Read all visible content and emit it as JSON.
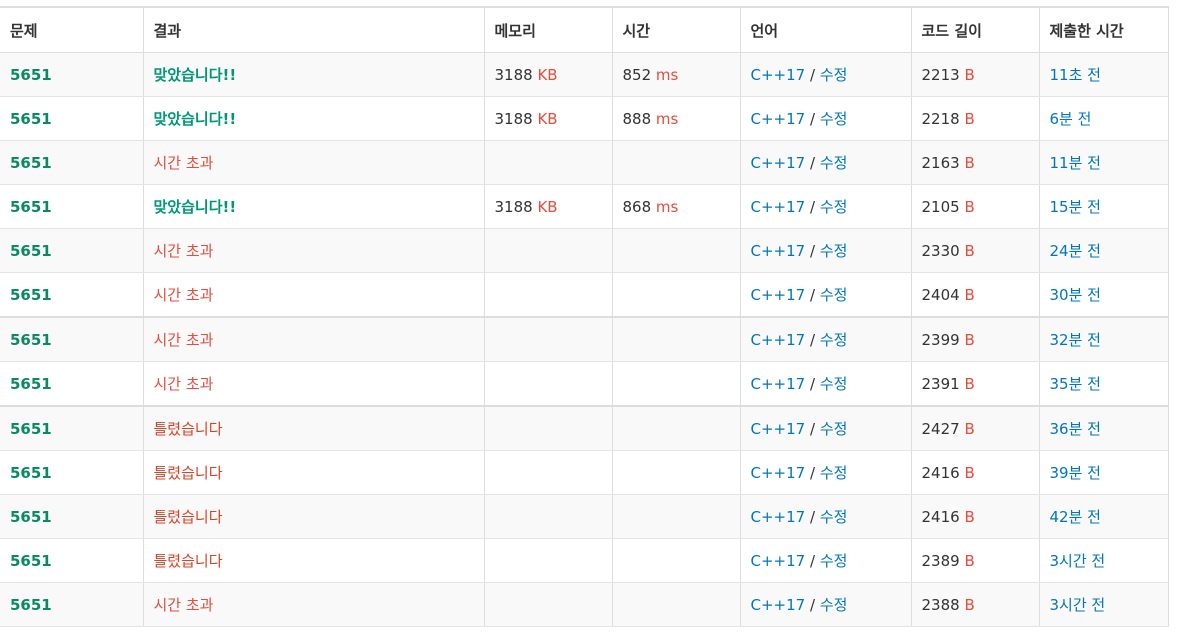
{
  "columns": [
    "문제",
    "결과",
    "메모리",
    "시간",
    "언어",
    "코드 길이",
    "제출한 시간"
  ],
  "rows": [
    {
      "problem": "5651",
      "result": "맞았습니다!!",
      "result_type": "ac",
      "memory": "3188",
      "memory_unit": "KB",
      "time": "852",
      "time_unit": "ms",
      "language": "C++17",
      "slash": "/",
      "edit": "수정",
      "code_length": "2213",
      "code_unit": "B",
      "submitted": "11초 전"
    },
    {
      "problem": "5651",
      "result": "맞았습니다!!",
      "result_type": "ac",
      "memory": "3188",
      "memory_unit": "KB",
      "time": "888",
      "time_unit": "ms",
      "language": "C++17",
      "slash": "/",
      "edit": "수정",
      "code_length": "2218",
      "code_unit": "B",
      "submitted": "6분 전"
    },
    {
      "problem": "5651",
      "result": "시간 초과",
      "result_type": "tle",
      "memory": "",
      "memory_unit": "",
      "time": "",
      "time_unit": "",
      "language": "C++17",
      "slash": "/",
      "edit": "수정",
      "code_length": "2163",
      "code_unit": "B",
      "submitted": "11분 전"
    },
    {
      "problem": "5651",
      "result": "맞았습니다!!",
      "result_type": "ac",
      "memory": "3188",
      "memory_unit": "KB",
      "time": "868",
      "time_unit": "ms",
      "language": "C++17",
      "slash": "/",
      "edit": "수정",
      "code_length": "2105",
      "code_unit": "B",
      "submitted": "15분 전"
    },
    {
      "problem": "5651",
      "result": "시간 초과",
      "result_type": "tle",
      "memory": "",
      "memory_unit": "",
      "time": "",
      "time_unit": "",
      "language": "C++17",
      "slash": "/",
      "edit": "수정",
      "code_length": "2330",
      "code_unit": "B",
      "submitted": "24분 전"
    },
    {
      "problem": "5651",
      "result": "시간 초과",
      "result_type": "tle",
      "memory": "",
      "memory_unit": "",
      "time": "",
      "time_unit": "",
      "language": "C++17",
      "slash": "/",
      "edit": "수정",
      "code_length": "2404",
      "code_unit": "B",
      "submitted": "30분 전"
    },
    {
      "problem": "5651",
      "result": "시간 초과",
      "result_type": "tle",
      "memory": "",
      "memory_unit": "",
      "time": "",
      "time_unit": "",
      "language": "C++17",
      "slash": "/",
      "edit": "수정",
      "code_length": "2399",
      "code_unit": "B",
      "submitted": "32분 전"
    },
    {
      "problem": "5651",
      "result": "시간 초과",
      "result_type": "tle",
      "memory": "",
      "memory_unit": "",
      "time": "",
      "time_unit": "",
      "language": "C++17",
      "slash": "/",
      "edit": "수정",
      "code_length": "2391",
      "code_unit": "B",
      "submitted": "35분 전"
    },
    {
      "problem": "5651",
      "result": "틀렸습니다",
      "result_type": "wa",
      "memory": "",
      "memory_unit": "",
      "time": "",
      "time_unit": "",
      "language": "C++17",
      "slash": "/",
      "edit": "수정",
      "code_length": "2427",
      "code_unit": "B",
      "submitted": "36분 전"
    },
    {
      "problem": "5651",
      "result": "틀렸습니다",
      "result_type": "wa",
      "memory": "",
      "memory_unit": "",
      "time": "",
      "time_unit": "",
      "language": "C++17",
      "slash": "/",
      "edit": "수정",
      "code_length": "2416",
      "code_unit": "B",
      "submitted": "39분 전"
    },
    {
      "problem": "5651",
      "result": "틀렸습니다",
      "result_type": "wa",
      "memory": "",
      "memory_unit": "",
      "time": "",
      "time_unit": "",
      "language": "C++17",
      "slash": "/",
      "edit": "수정",
      "code_length": "2416",
      "code_unit": "B",
      "submitted": "42분 전"
    },
    {
      "problem": "5651",
      "result": "틀렸습니다",
      "result_type": "wa",
      "memory": "",
      "memory_unit": "",
      "time": "",
      "time_unit": "",
      "language": "C++17",
      "slash": "/",
      "edit": "수정",
      "code_length": "2389",
      "code_unit": "B",
      "submitted": "3시간 전"
    },
    {
      "problem": "5651",
      "result": "시간 초과",
      "result_type": "tle",
      "memory": "",
      "memory_unit": "",
      "time": "",
      "time_unit": "",
      "language": "C++17",
      "slash": "/",
      "edit": "수정",
      "code_length": "2388",
      "code_unit": "B",
      "submitted": "3시간 전"
    }
  ],
  "colors": {
    "accepted": "#009874",
    "time_limit": "#e74c3c",
    "wrong_answer": "#dd4124",
    "link": "#0076c0",
    "problem": "#0a8a62",
    "unit": "#e74c3c"
  }
}
